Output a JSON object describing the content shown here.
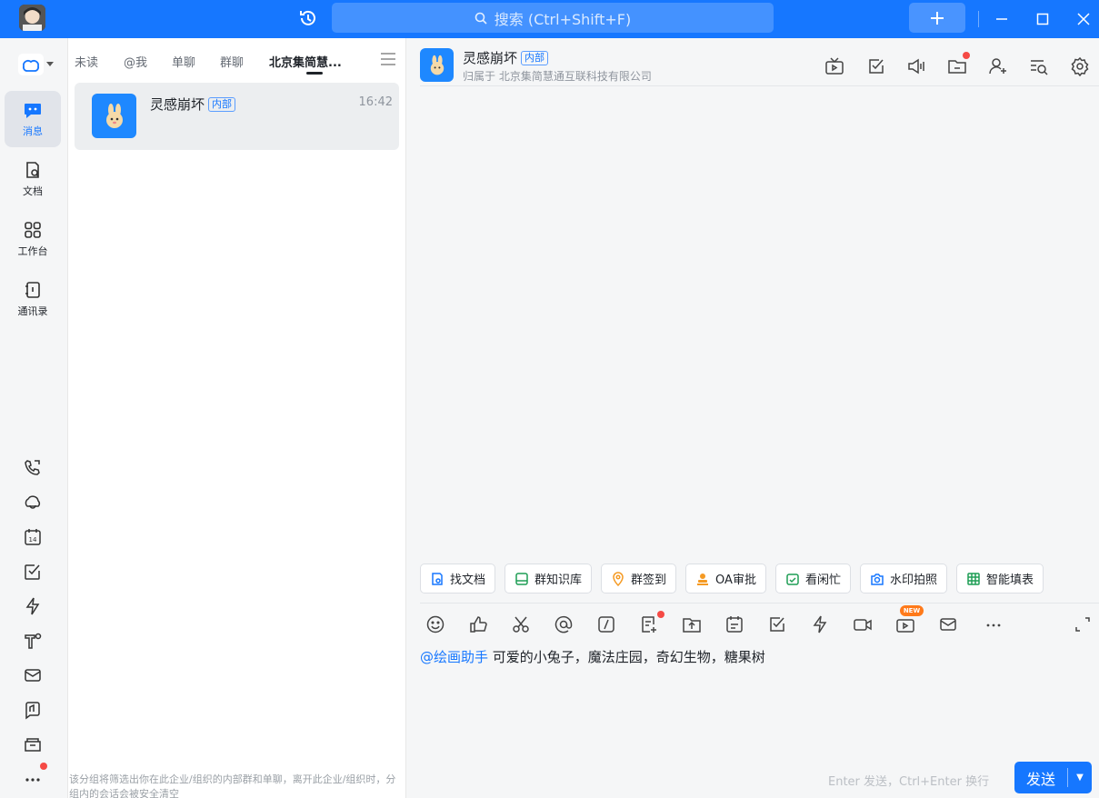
{
  "titlebar": {
    "search_placeholder": "搜索 (Ctrl+Shift+F)",
    "accent": "#1677ff"
  },
  "rail": {
    "items": [
      {
        "label": "消息",
        "icon": "message-icon",
        "active": true
      },
      {
        "label": "文档",
        "icon": "document-icon"
      },
      {
        "label": "工作台",
        "icon": "workbench-icon"
      },
      {
        "label": "通讯录",
        "icon": "contacts-icon"
      }
    ],
    "bottom_icons": [
      "phone-icon",
      "cloud-icon",
      "calendar-icon",
      "todo-icon",
      "lightning-icon",
      "tools-icon",
      "mail-icon",
      "minutes-icon",
      "files-icon",
      "more-icon"
    ],
    "calendar_day": "14"
  },
  "list": {
    "tabs": [
      "未读",
      "@我",
      "单聊",
      "群聊",
      "北京集简慧..."
    ],
    "active_tab": 4,
    "conversation": {
      "name": "灵感崩坏",
      "tag": "内部",
      "time": "16:42"
    },
    "filter_note": "该分组将筛选出你在此企业/组织的内部群和单聊，离开此企业/组织时，分组内的会话会被安全清空"
  },
  "chat": {
    "title": "灵感崩坏",
    "tag": "内部",
    "subtitle": "归属于 北京集简慧通互联科技有限公司",
    "quick_actions": [
      "找文档",
      "群知识库",
      "群签到",
      "OA审批",
      "看闲忙",
      "水印拍照",
      "智能填表"
    ],
    "input_mention": "@绘画助手",
    "input_text": " 可爱的小兔子，魔法庄园，奇幻生物，糖果树",
    "hint": "Enter 发送，Ctrl+Enter 换行",
    "send_label": "发送",
    "new_badge": "NEW"
  }
}
